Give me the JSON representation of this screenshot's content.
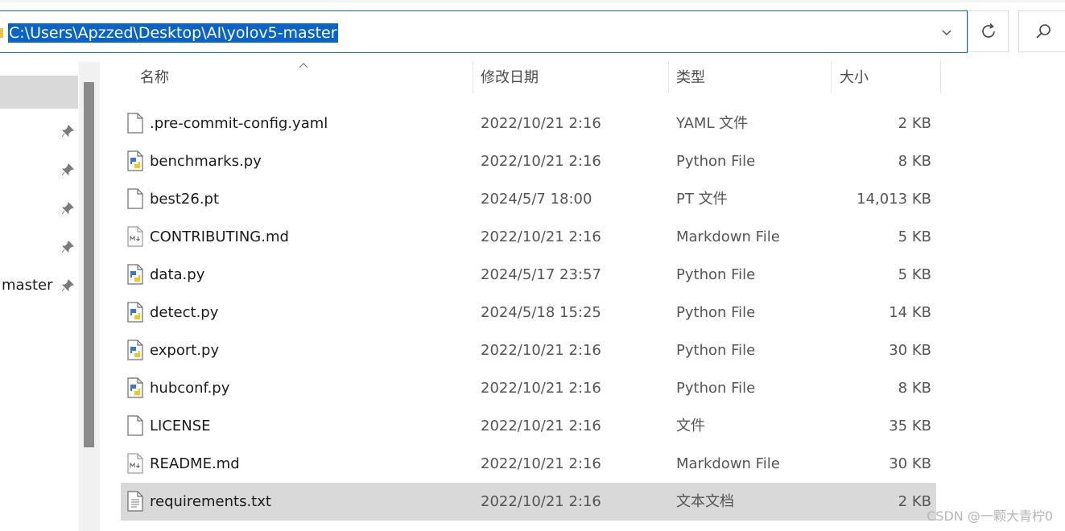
{
  "address_bar": {
    "path": "C:\\Users\\Apzzed\\Desktop\\AI\\yolov5-master"
  },
  "nav_pane": {
    "visible_label": "master",
    "pinned_count": 5
  },
  "columns": {
    "name": "名称",
    "date": "修改日期",
    "type": "类型",
    "size": "大小"
  },
  "files": [
    {
      "name": ".pre-commit-config.yaml",
      "date": "2022/10/21 2:16",
      "type": "YAML 文件",
      "size": "2 KB",
      "icon": "file-icon"
    },
    {
      "name": "benchmarks.py",
      "date": "2022/10/21 2:16",
      "type": "Python File",
      "size": "8 KB",
      "icon": "python-file-icon"
    },
    {
      "name": "best26.pt",
      "date": "2024/5/7 18:00",
      "type": "PT 文件",
      "size": "14,013 KB",
      "icon": "file-icon"
    },
    {
      "name": "CONTRIBUTING.md",
      "date": "2022/10/21 2:16",
      "type": "Markdown File",
      "size": "5 KB",
      "icon": "markdown-file-icon"
    },
    {
      "name": "data.py",
      "date": "2024/5/17 23:57",
      "type": "Python File",
      "size": "5 KB",
      "icon": "python-file-icon"
    },
    {
      "name": "detect.py",
      "date": "2024/5/18 15:25",
      "type": "Python File",
      "size": "14 KB",
      "icon": "python-file-icon"
    },
    {
      "name": "export.py",
      "date": "2022/10/21 2:16",
      "type": "Python File",
      "size": "30 KB",
      "icon": "python-file-icon"
    },
    {
      "name": "hubconf.py",
      "date": "2022/10/21 2:16",
      "type": "Python File",
      "size": "8 KB",
      "icon": "python-file-icon"
    },
    {
      "name": "LICENSE",
      "date": "2022/10/21 2:16",
      "type": "文件",
      "size": "35 KB",
      "icon": "file-icon"
    },
    {
      "name": "README.md",
      "date": "2022/10/21 2:16",
      "type": "Markdown File",
      "size": "30 KB",
      "icon": "markdown-file-icon"
    },
    {
      "name": "requirements.txt",
      "date": "2022/10/21 2:16",
      "type": "文本文档",
      "size": "2 KB",
      "icon": "text-file-icon",
      "selected": true
    }
  ],
  "watermark": "CSDN @一颗大青柠0",
  "colors": {
    "selection_blue": "#0a63c9",
    "row_selected": "#d9d9d9",
    "python_blue": "#3b78c4",
    "python_yellow": "#f5c518"
  }
}
